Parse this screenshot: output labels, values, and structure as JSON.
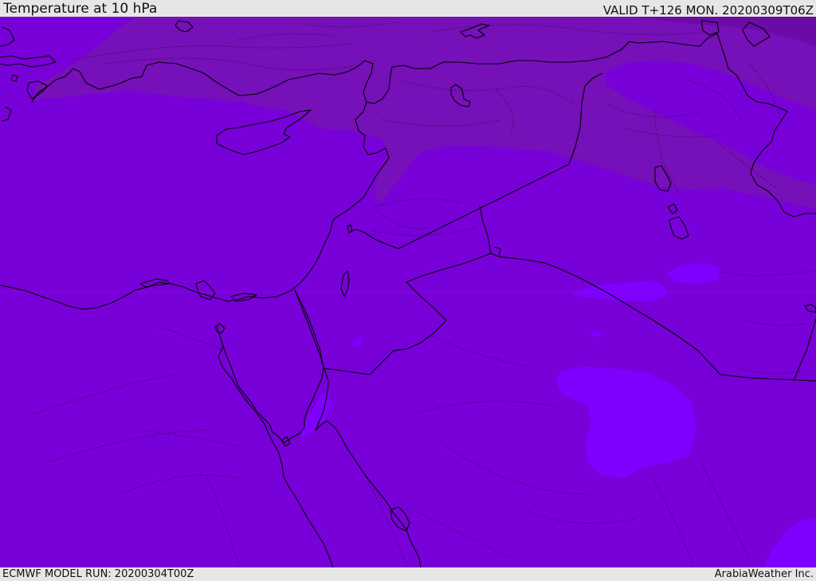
{
  "header": {
    "title": "Temperature at 10 hPa",
    "valid_time": "VALID T+126 MON. 20200309T06Z"
  },
  "footer": {
    "model_run": "ECMWF MODEL RUN: 20200304T00Z",
    "credit": "ArabiaWeather Inc."
  },
  "map": {
    "variable": "temperature",
    "pressure_level_hpa": 10,
    "colors": {
      "base_fill": "#7800d8",
      "cold_north_fill": "#7610b8",
      "darkest_fill": "#6c0aa8",
      "warm_patch_fill": "#7e00ff",
      "coastline": "#000000",
      "contour_dotted": "#000000"
    }
  }
}
